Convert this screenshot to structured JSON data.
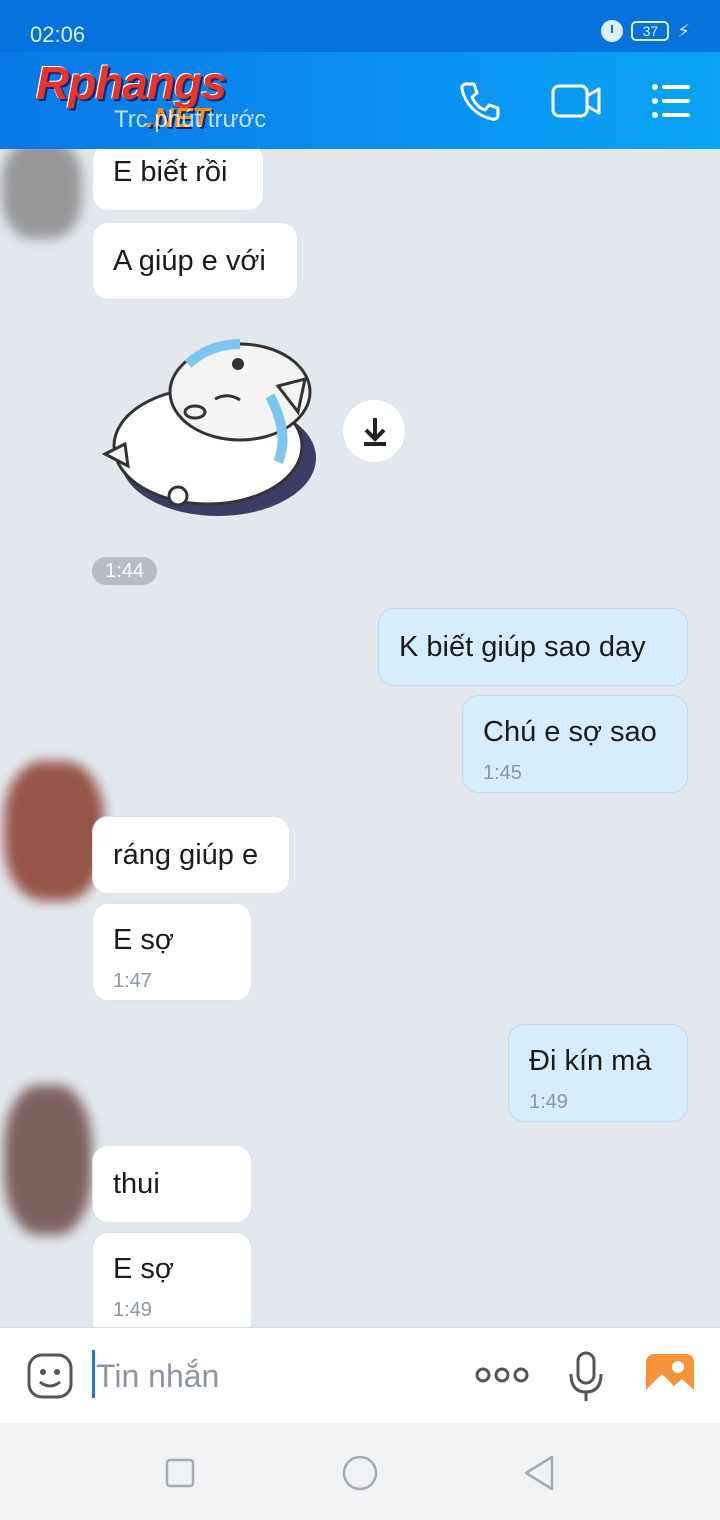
{
  "status_bar": {
    "time": "02:06",
    "battery": "37"
  },
  "header": {
    "logo_main": "Rphangs",
    "logo_sub": ".NET",
    "subtitle": "Trc phút trước"
  },
  "messages": [
    {
      "dir": "in",
      "text": "E biết rồi"
    },
    {
      "dir": "in",
      "text": "A giúp e với"
    },
    {
      "dir": "in",
      "sticker": "crying-cat-sticker",
      "time": "1:44"
    },
    {
      "dir": "out",
      "text": "K biết giúp sao day"
    },
    {
      "dir": "out",
      "text": "Chú e sợ sao",
      "time": "1:45"
    },
    {
      "dir": "in",
      "text": "ráng giúp e"
    },
    {
      "dir": "in",
      "text": "E sợ",
      "time": "1:47"
    },
    {
      "dir": "out",
      "text": "Đi kín mà",
      "time": "1:49"
    },
    {
      "dir": "in",
      "text": "thui"
    },
    {
      "dir": "in",
      "text": "E sợ",
      "time": "1:49"
    }
  ],
  "input": {
    "placeholder": "Tin nhắn"
  },
  "colors": {
    "header": "#0a8cf0",
    "outgoing_bubble": "#d6edfd",
    "incoming_bubble": "#ffffff",
    "chat_bg": "#e3e8ef"
  }
}
